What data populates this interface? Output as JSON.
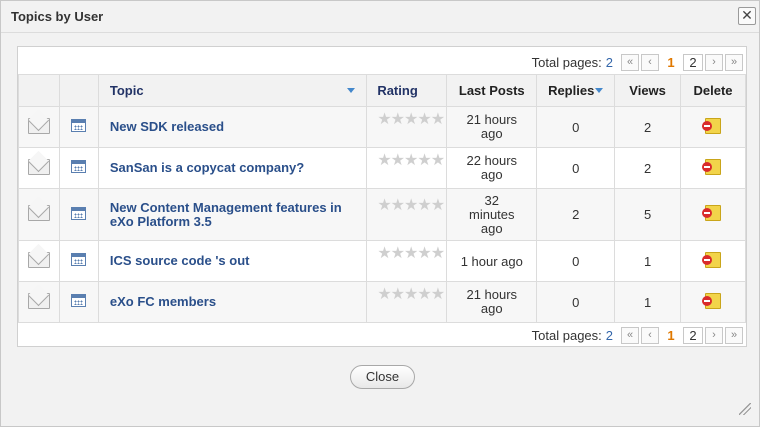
{
  "dialog": {
    "title": "Topics by User",
    "close_symbol": "✕"
  },
  "pager": {
    "label": "Total pages:",
    "total": "2",
    "first": "«",
    "prev": "‹",
    "current": "1",
    "next_page": "2",
    "next": "›",
    "last": "»"
  },
  "table": {
    "columns": {
      "topic": "Topic",
      "rating": "Rating",
      "last_posts": "Last Posts",
      "replies": "Replies",
      "views": "Views",
      "delete": "Delete"
    },
    "rows": [
      {
        "topic": "New SDK released",
        "rating": 0,
        "last_post": "21 hours ago",
        "replies": "0",
        "views": "2"
      },
      {
        "topic": "SanSan is a copycat company?",
        "rating": 0,
        "last_post": "22 hours ago",
        "replies": "0",
        "views": "2"
      },
      {
        "topic": "New Content Management features in eXo Platform 3.5",
        "rating": 0,
        "last_post": "32 minutes ago",
        "replies": "2",
        "views": "5"
      },
      {
        "topic": "ICS source code 's out",
        "rating": 0,
        "last_post": "1 hour ago",
        "replies": "0",
        "views": "1"
      },
      {
        "topic": "eXo FC members",
        "rating": 0,
        "last_post": "21 hours ago",
        "replies": "0",
        "views": "1"
      }
    ]
  },
  "footer": {
    "close_label": "Close"
  },
  "icons": {
    "envelope": "envelope-icon",
    "calendar": "calendar-icon",
    "delete": "delete-icon",
    "stars": "★★★★★"
  }
}
